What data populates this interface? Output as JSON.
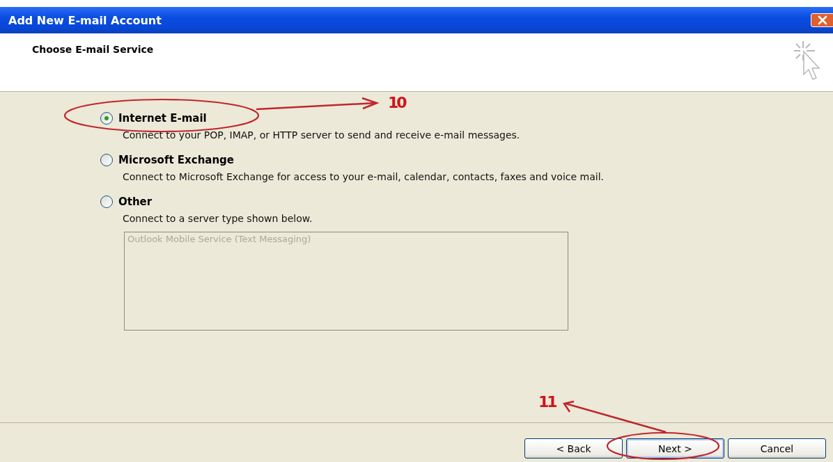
{
  "window": {
    "title": "Add New E-mail Account"
  },
  "header": {
    "heading": "Choose E-mail Service"
  },
  "options": [
    {
      "label": "Internet E-mail",
      "description": "Connect to your POP, IMAP, or HTTP server to send and receive e-mail messages.",
      "selected": true
    },
    {
      "label": "Microsoft Exchange",
      "description": "Connect to Microsoft Exchange for access to your e-mail, calendar, contacts, faxes and voice mail.",
      "selected": false
    },
    {
      "label": "Other",
      "description": "Connect to a server type shown below.",
      "selected": false
    }
  ],
  "server_list": {
    "items": [
      {
        "label": "Outlook Mobile Service (Text Messaging)",
        "disabled": true
      }
    ]
  },
  "buttons": [
    {
      "label": "< Back"
    },
    {
      "label": "Next >"
    },
    {
      "label": "Cancel"
    }
  ],
  "annotations": [
    {
      "label": "10"
    },
    {
      "label": "11"
    }
  ]
}
